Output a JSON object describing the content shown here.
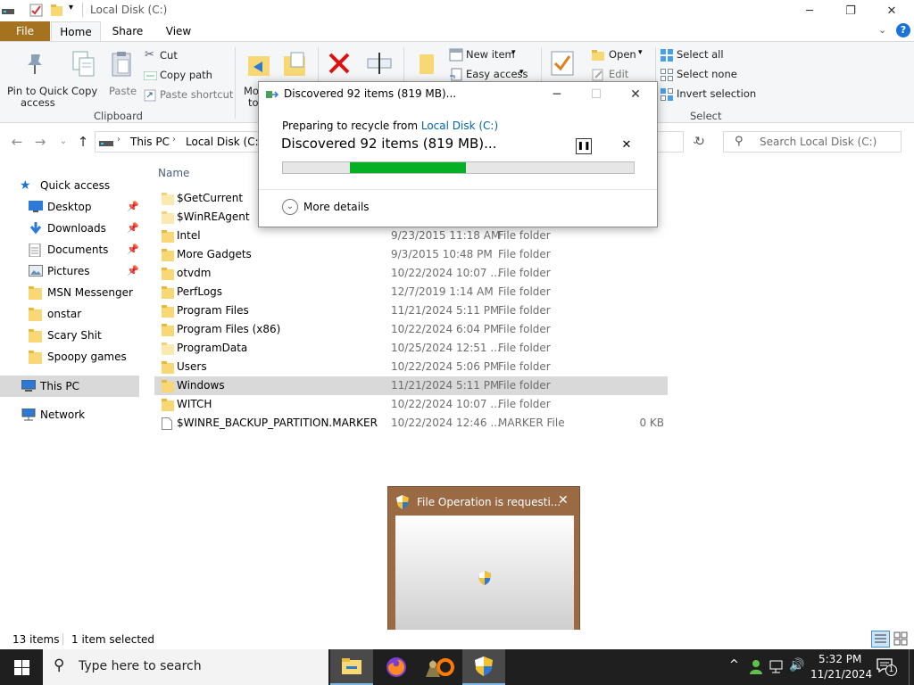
{
  "window": {
    "title": "Local Disk (C:)"
  },
  "tabs": {
    "file": "File",
    "home": "Home",
    "share": "Share",
    "view": "View",
    "help": "?"
  },
  "ribbon": {
    "pin_quick_access": [
      "Pin to Quick",
      "access"
    ],
    "copy": "Copy",
    "paste": "Paste",
    "cut": "Cut",
    "copy_path": "Copy path",
    "paste_shortcut": "Paste shortcut",
    "clipboard": "Clipboard",
    "move_to": [
      "Mo",
      "to"
    ],
    "new_item": "New item",
    "easy_access": "Easy access",
    "open": "Open",
    "edit": "Edit",
    "select_all": "Select all",
    "select_none": "Select none",
    "invert_selection": "Invert selection",
    "select_group": "Select"
  },
  "address": {
    "this_pc": "This PC",
    "local_disk": "Local Disk (C:)",
    "search_placeholder": "Search Local Disk (C:)"
  },
  "nav": {
    "quick_access": "Quick access",
    "items": [
      {
        "label": "Desktop",
        "pinned": true
      },
      {
        "label": "Downloads",
        "pinned": true
      },
      {
        "label": "Documents",
        "pinned": true
      },
      {
        "label": "Pictures",
        "pinned": true
      },
      {
        "label": "MSN Messenger"
      },
      {
        "label": "onstar"
      },
      {
        "label": "Scary Shit"
      },
      {
        "label": "Spoopy games"
      }
    ],
    "this_pc": "This PC",
    "network": "Network"
  },
  "files": {
    "column_name": "Name",
    "rows": [
      {
        "name": "$GetCurrent",
        "date": "",
        "type": "",
        "size": ""
      },
      {
        "name": "$WinREAgent",
        "date": "",
        "type": "",
        "size": ""
      },
      {
        "name": "Intel",
        "date": "9/23/2015 11:18 AM",
        "type": "File folder",
        "size": ""
      },
      {
        "name": "More Gadgets",
        "date": "9/3/2015 10:48 PM",
        "type": "File folder",
        "size": ""
      },
      {
        "name": "otvdm",
        "date": "10/22/2024 10:07 ...",
        "type": "File folder",
        "size": ""
      },
      {
        "name": "PerfLogs",
        "date": "12/7/2019 1:14 AM",
        "type": "File folder",
        "size": ""
      },
      {
        "name": "Program Files",
        "date": "11/21/2024 5:11 PM",
        "type": "File folder",
        "size": ""
      },
      {
        "name": "Program Files (x86)",
        "date": "10/22/2024 6:04 PM",
        "type": "File folder",
        "size": ""
      },
      {
        "name": "ProgramData",
        "date": "10/25/2024 12:51 ...",
        "type": "File folder",
        "size": ""
      },
      {
        "name": "Users",
        "date": "10/22/2024 5:06 PM",
        "type": "File folder",
        "size": ""
      },
      {
        "name": "Windows",
        "date": "11/21/2024 5:11 PM",
        "type": "File folder",
        "size": "",
        "selected": true
      },
      {
        "name": "WITCH",
        "date": "10/22/2024 10:07 ...",
        "type": "File folder",
        "size": ""
      },
      {
        "name": "$WINRE_BACKUP_PARTITION.MARKER",
        "date": "10/22/2024 12:46 ...",
        "type": "MARKER File",
        "size": "0 KB"
      }
    ]
  },
  "progress_dialog": {
    "title": "Discovered 92 items (819 MB)...",
    "preparing_prefix": "Preparing to recycle from",
    "source_link": "Local Disk (C:)",
    "heading": "Discovered 92 items (819 MB)...",
    "more_details": "More details",
    "progress_fill_start": 0.19,
    "progress_fill_end": 0.52,
    "progress_color": "#06b025"
  },
  "uac": {
    "title": "File Operation is requesti..."
  },
  "status": {
    "items": "13 items",
    "selected": "1 item selected"
  },
  "taskbar": {
    "search_placeholder": "Type here to search",
    "time": "5:32 PM",
    "date": "11/21/2024",
    "notification_count": "1"
  }
}
